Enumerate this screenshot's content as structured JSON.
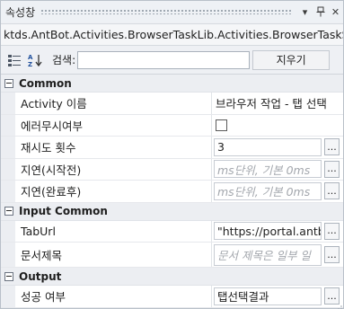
{
  "window": {
    "title": "속성창",
    "dropdown_glyph": "▾",
    "pin_glyph": "ᅖ",
    "close_glyph": "✕"
  },
  "type_name": "ktds.AntBot.Activities.BrowserTaskLib.Activities.BrowserTaskSelectT...",
  "toolbar": {
    "search_label": "검색:",
    "search_value": "",
    "clear_label": "지우기"
  },
  "categories": [
    {
      "label": "Common",
      "rows": [
        {
          "name": "Activity 이름",
          "kind": "plain",
          "value": "브라우저 작업 - 탭 선택"
        },
        {
          "name": "에러무시여부",
          "kind": "checkbox",
          "checked": false
        },
        {
          "name": "재시도 횟수",
          "kind": "box",
          "value": "3"
        },
        {
          "name": "지연(시작전)",
          "kind": "placeholder",
          "value": "ms단위, 기본 0ms"
        },
        {
          "name": "지연(완료후)",
          "kind": "placeholder",
          "value": "ms단위, 기본 0ms"
        }
      ]
    },
    {
      "label": "Input Common",
      "rows": [
        {
          "name": "TabUrl",
          "kind": "box",
          "value": "\"https://portal.antbot"
        },
        {
          "name": "문서제목",
          "kind": "placeholder",
          "value": "문서 제목은 일부 일"
        }
      ]
    },
    {
      "label": "Output",
      "rows": [
        {
          "name": "성공 여부",
          "kind": "box",
          "value": "탭선택결과"
        }
      ]
    }
  ],
  "dots_label": "...",
  "colors": {
    "chrome": "#eef0f4",
    "border": "#b9c0c9",
    "placeholder": "#a3a7ad"
  }
}
